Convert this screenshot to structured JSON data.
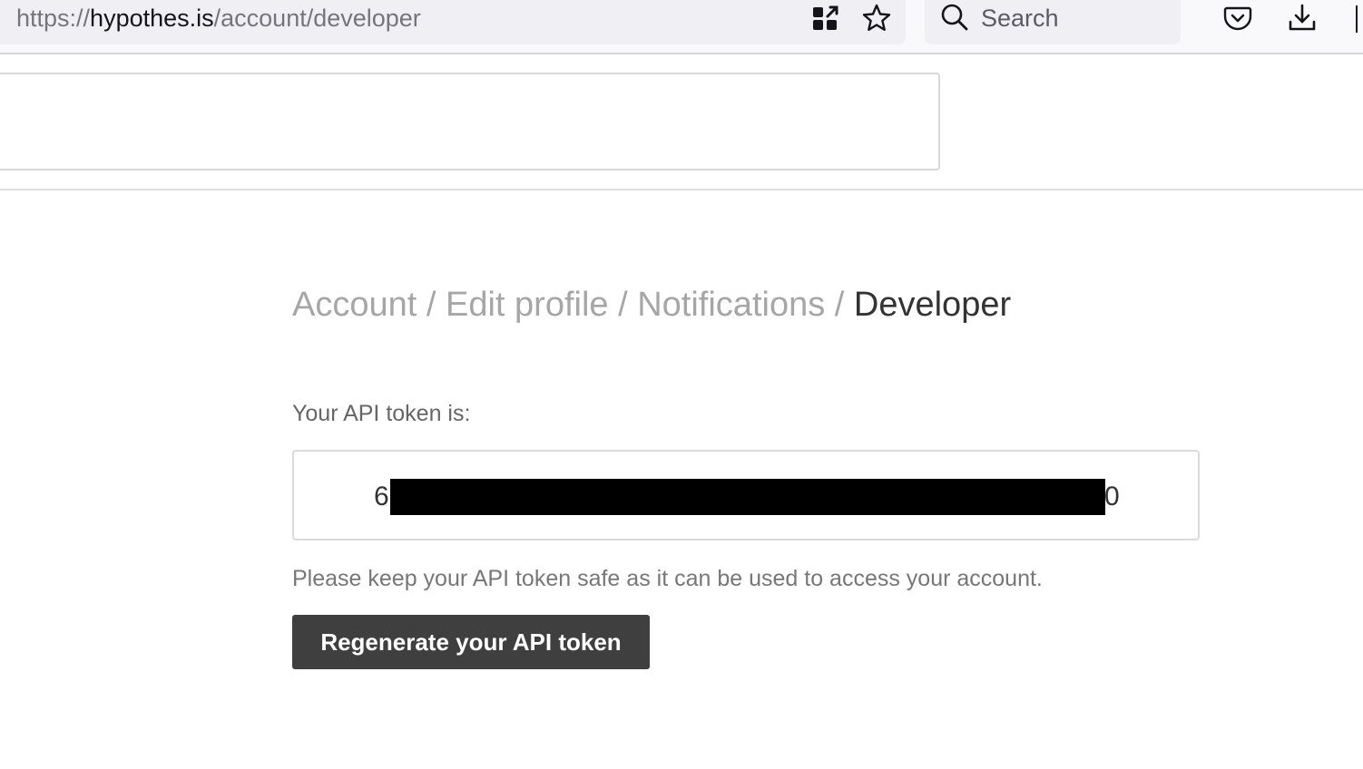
{
  "browser": {
    "url_scheme": "https://",
    "url_host": "hypothes.is",
    "url_path": "/account/developer",
    "search_placeholder": "Search",
    "icons": {
      "qr": "qr-code-icon",
      "bookmark": "star-icon",
      "search": "search-icon",
      "pocket": "pocket-icon",
      "downloads": "download-icon"
    }
  },
  "nav": {
    "items": [
      "Account",
      "Edit profile",
      "Notifications"
    ],
    "separator": "/",
    "current": "Developer"
  },
  "token": {
    "label": "Your API token is:",
    "first_char": "6",
    "last_char": "0",
    "warning": "Please keep your API token safe as it can be used to access your account."
  },
  "actions": {
    "regenerate_label": "Regenerate your API token"
  },
  "colors": {
    "button_bg": "#3f3f3f",
    "nav_inactive": "#a6a6a6",
    "nav_active": "#333333"
  }
}
